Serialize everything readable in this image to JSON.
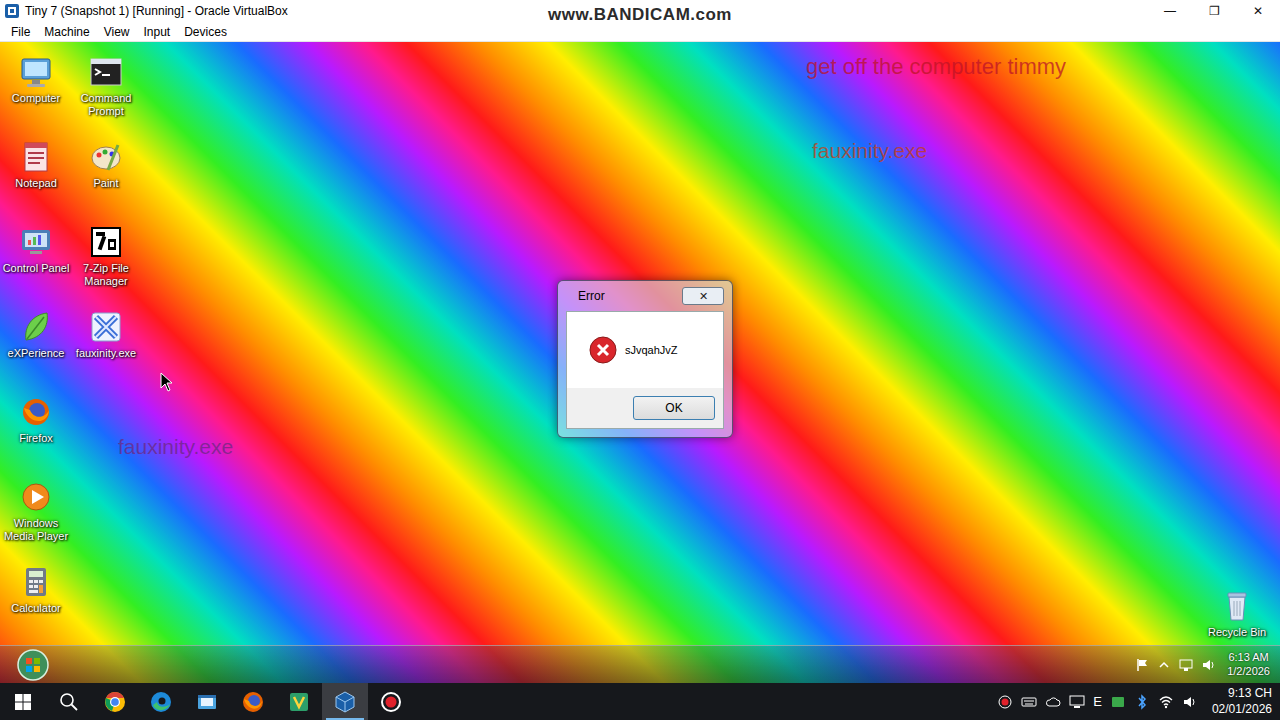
{
  "window": {
    "title": "Tiny 7 (Snapshot 1) [Running] - Oracle VirtualBox",
    "controls": [
      "—",
      "❐",
      "✕"
    ]
  },
  "watermark": "www.BANDICAM.com",
  "menu": [
    "File",
    "Machine",
    "View",
    "Input",
    "Devices"
  ],
  "guest": {
    "desktop_icons": [
      {
        "label": "Computer"
      },
      {
        "label": "Notepad"
      },
      {
        "label": "Control Panel"
      },
      {
        "label": "eXPerience"
      },
      {
        "label": "Firefox"
      },
      {
        "label": "Windows Media Player"
      },
      {
        "label": "Calculator"
      },
      {
        "label": "Command Prompt"
      },
      {
        "label": "Paint"
      },
      {
        "label": "7-Zip File Manager"
      },
      {
        "label": "fauxinity.exe"
      }
    ],
    "recycle_bin": {
      "label": "Recycle Bin"
    },
    "overlays": [
      {
        "text": "get off the computer timmy"
      },
      {
        "text": "fauxinity.exe"
      },
      {
        "text": "fauxinity.exe"
      }
    ],
    "dialog": {
      "title": "Error",
      "close": "✕",
      "message": "sJvqahJvZ",
      "button": "OK"
    },
    "taskbar": {
      "time": "6:13 AM",
      "date": "1/2/2026"
    }
  },
  "host_taskbar": {
    "apps": [
      {
        "selected": false
      },
      {
        "selected": false
      },
      {
        "selected": false
      },
      {
        "selected": false
      },
      {
        "selected": false
      },
      {
        "selected": true
      },
      {
        "selected": false
      }
    ],
    "ime": "E",
    "time": "9:13 CH",
    "date": "02/01/2026"
  }
}
